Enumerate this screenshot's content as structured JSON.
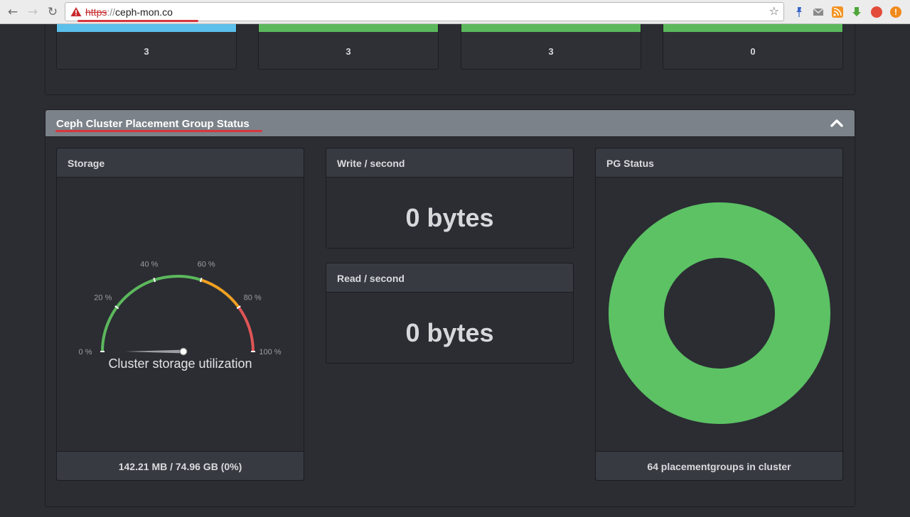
{
  "browser": {
    "url_scheme": "https",
    "url_separator": "://",
    "url_host": "ceph-mon.co",
    "icons": [
      "back-icon",
      "forward-icon",
      "reload-icon",
      "security-warning-icon",
      "bookmark-star-icon",
      "menu-icon"
    ]
  },
  "top_counts": [
    {
      "value": "3",
      "color": "#5bc0eb"
    },
    {
      "value": "3",
      "color": "#5cb85c"
    },
    {
      "value": "3",
      "color": "#5cb85c"
    },
    {
      "value": "0",
      "color": "#5cb85c"
    }
  ],
  "pg_panel": {
    "title": "Ceph Cluster Placement Group Status",
    "storage": {
      "header": "Storage",
      "gauge_label": "Cluster storage utilization",
      "value_percent": 0,
      "ticks": [
        "0 %",
        "20 %",
        "40 %",
        "60 %",
        "80 %",
        "100 %"
      ],
      "footer": "142.21 MB / 74.96 GB (0%)",
      "band_colors": {
        "green": "#5cb85c",
        "orange": "#f0a020",
        "red": "#e05555"
      }
    },
    "write": {
      "header": "Write / second",
      "value": "0 bytes"
    },
    "read": {
      "header": "Read / second",
      "value": "0 bytes"
    },
    "pg_status": {
      "header": "PG Status",
      "footer": "64 placementgroups in cluster",
      "color": "#5cc264",
      "share": 1.0
    }
  }
}
